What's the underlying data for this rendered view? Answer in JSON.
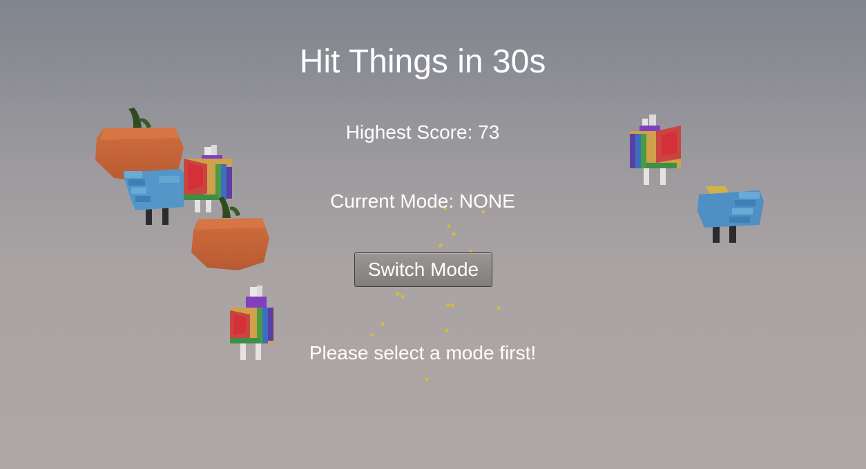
{
  "hud": {
    "title": "Hit Things in 30s",
    "highest_score": "Highest Score: 73",
    "current_mode": "Current Mode: NONE",
    "switch_button": "Switch Mode",
    "message": "Please select a mode first!"
  },
  "scene": {
    "targets": [
      "pumpkin",
      "pumpkin",
      "rainbow-chicken",
      "rainbow-chicken",
      "rainbow-chicken",
      "blue-sheep",
      "blue-sheep"
    ],
    "colors": {
      "pumpkin": "#c8673a",
      "stem": "#2d4a1f",
      "sheep": "#4f8fc4",
      "sky": "#80848d",
      "ground": "#ada6a4",
      "particles": "#d8c03a"
    }
  }
}
